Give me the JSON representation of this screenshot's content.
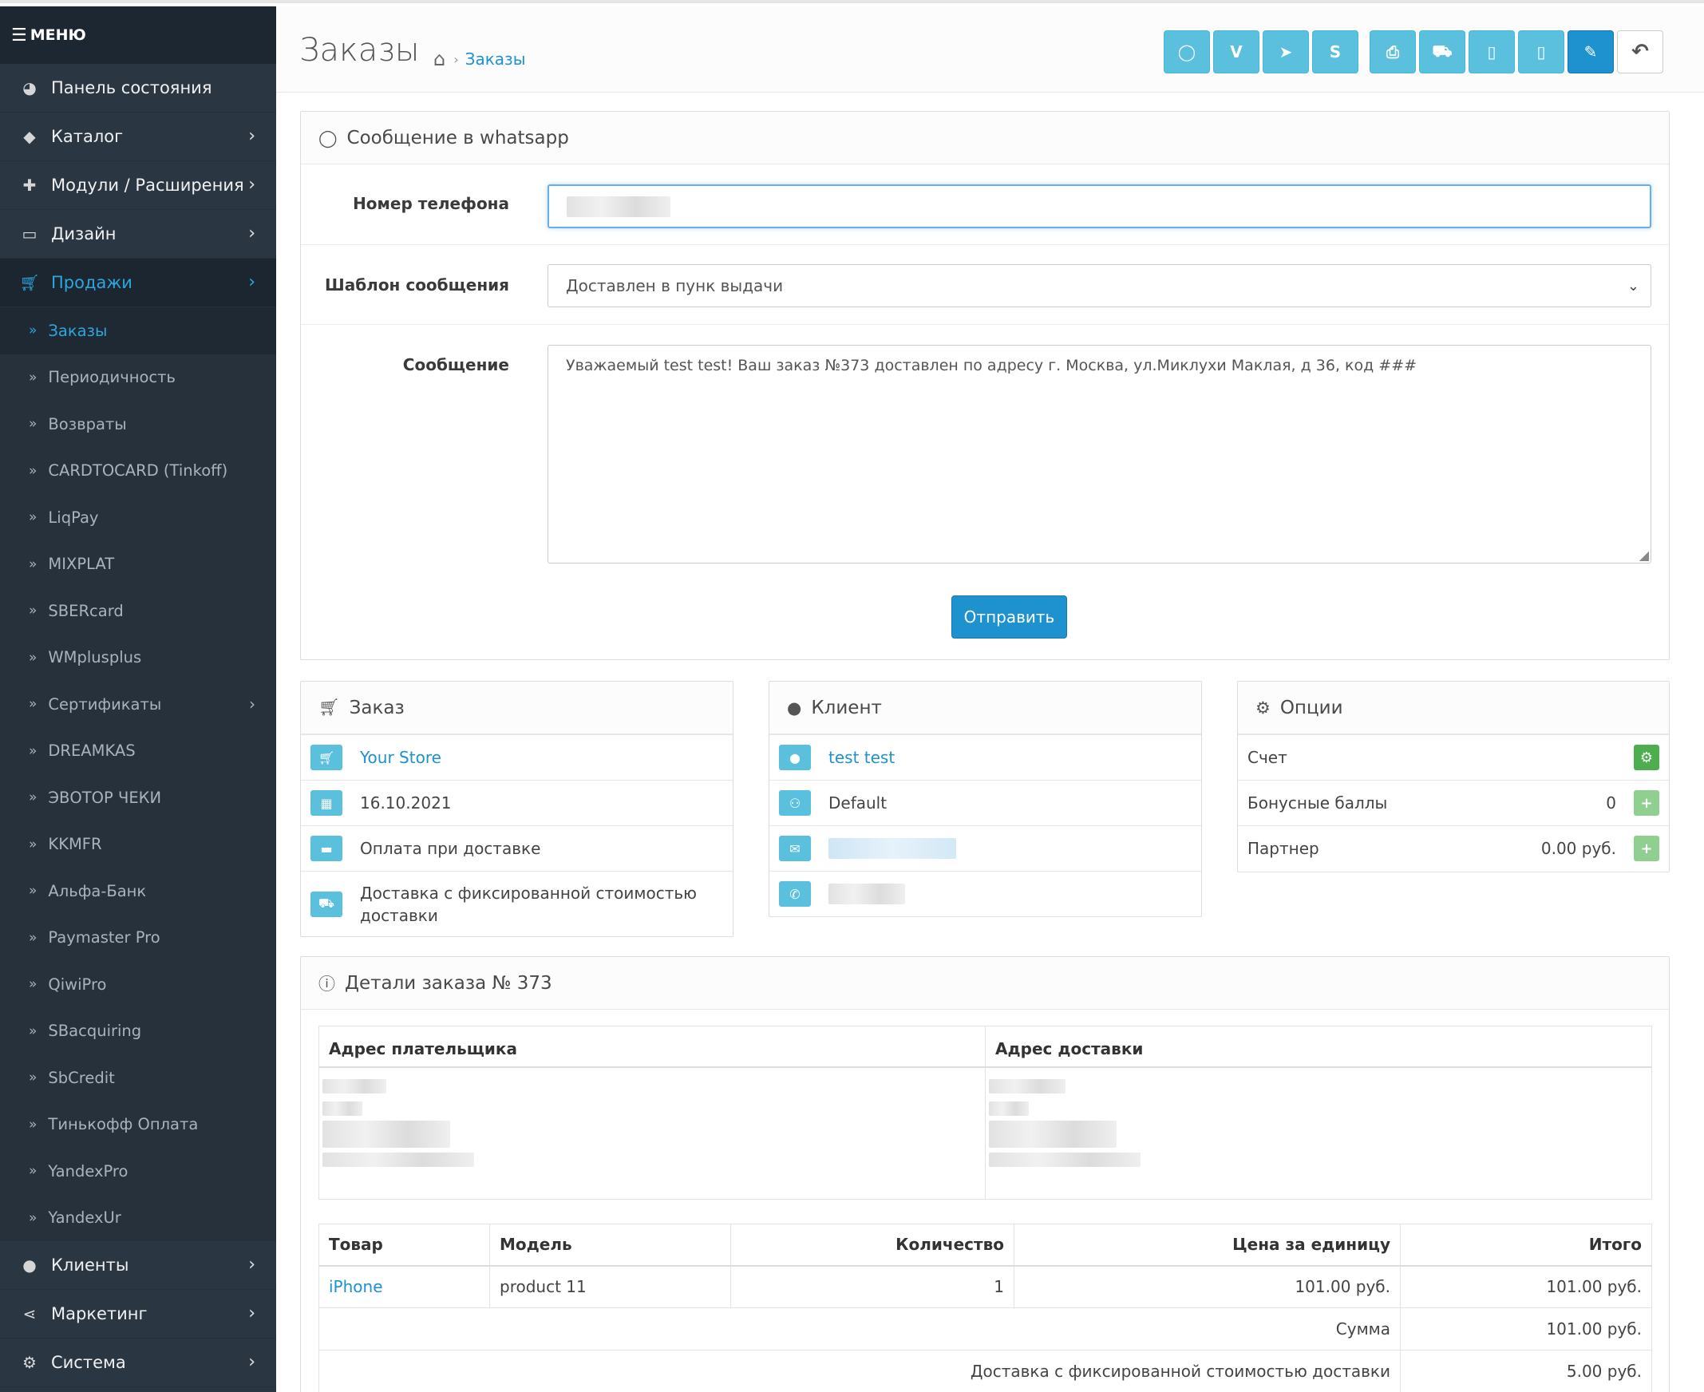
{
  "menu": {
    "header": "МЕНЮ",
    "items": [
      {
        "label": "Панель состояния",
        "icon": "dashboard-icon",
        "chev": false
      },
      {
        "label": "Каталог",
        "icon": "tags-icon",
        "chev": true
      },
      {
        "label": "Модули / Расширения",
        "icon": "puzzle-icon",
        "chev": true
      },
      {
        "label": "Дизайн",
        "icon": "desktop-icon",
        "chev": true
      },
      {
        "label": "Продажи",
        "icon": "cart-icon",
        "chev": true,
        "active": true
      }
    ],
    "sub": [
      "Заказы",
      "Периодичность",
      "Возвраты",
      "CARDTOCARD (Tinkoff)",
      "LiqPay",
      "MIXPLAT",
      "SBERcard",
      "WMplusplus",
      "Сертификаты",
      "DREAMKAS",
      "ЭВОТОР ЧЕКИ",
      "KKMFR",
      "Альфа-Банк",
      "Paymaster Pro",
      "QiwiPro",
      "SBacquiring",
      "SbCredit",
      "Тинькофф Оплата",
      "YandexPro",
      "YandexUr"
    ],
    "bottom": [
      {
        "label": "Клиенты",
        "icon": "user-icon"
      },
      {
        "label": "Маркетинг",
        "icon": "share-icon"
      },
      {
        "label": "Система",
        "icon": "cog-icon"
      }
    ]
  },
  "header": {
    "title": "Заказы",
    "breadcrumb": "Заказы"
  },
  "toolbar": {
    "edit_icon": "pencil-icon",
    "back_icon": "reply-icon"
  },
  "whatsapp": {
    "title": "Сообщение в whatsapp",
    "phone_label": "Номер телефона",
    "template_label": "Шаблон сообщения",
    "template_value": "Доставлен в пунк выдачи",
    "message_label": "Сообщение",
    "message_value": "Уважаемый test test! Ваш заказ №373 доставлен по адресу г. Москва, ул.Миклухи Маклая, д 36, код ###",
    "send": "Отправить"
  },
  "order": {
    "title": "Заказ",
    "store": "Your Store",
    "date": "16.10.2021",
    "payment": "Оплата при доставке",
    "shipping_line1": "Доставка с фиксированной стоимостью",
    "shipping_line2": "доставки"
  },
  "client": {
    "title": "Клиент",
    "name": "test test",
    "group": "Default"
  },
  "options": {
    "title": "Опции",
    "invoice": "Счет",
    "bonus": "Бонусные баллы",
    "bonus_value": "0",
    "partner": "Партнер",
    "partner_value": "0.00 руб."
  },
  "details": {
    "title": "Детали заказа № 373",
    "payer_addr": "Адрес плательщика",
    "ship_addr": "Адрес доставки",
    "cols": [
      "Товар",
      "Модель",
      "Количество",
      "Цена за единицу",
      "Итого"
    ],
    "product": {
      "name": "iPhone",
      "model": "product 11",
      "qty": "1",
      "price": "101.00 руб.",
      "total": "101.00 руб."
    },
    "sum_label": "Сумма",
    "sum_value": "101.00 руб.",
    "ship_label": "Доставка с фиксированной стоимостью доставки",
    "ship_value": "5.00 руб."
  }
}
